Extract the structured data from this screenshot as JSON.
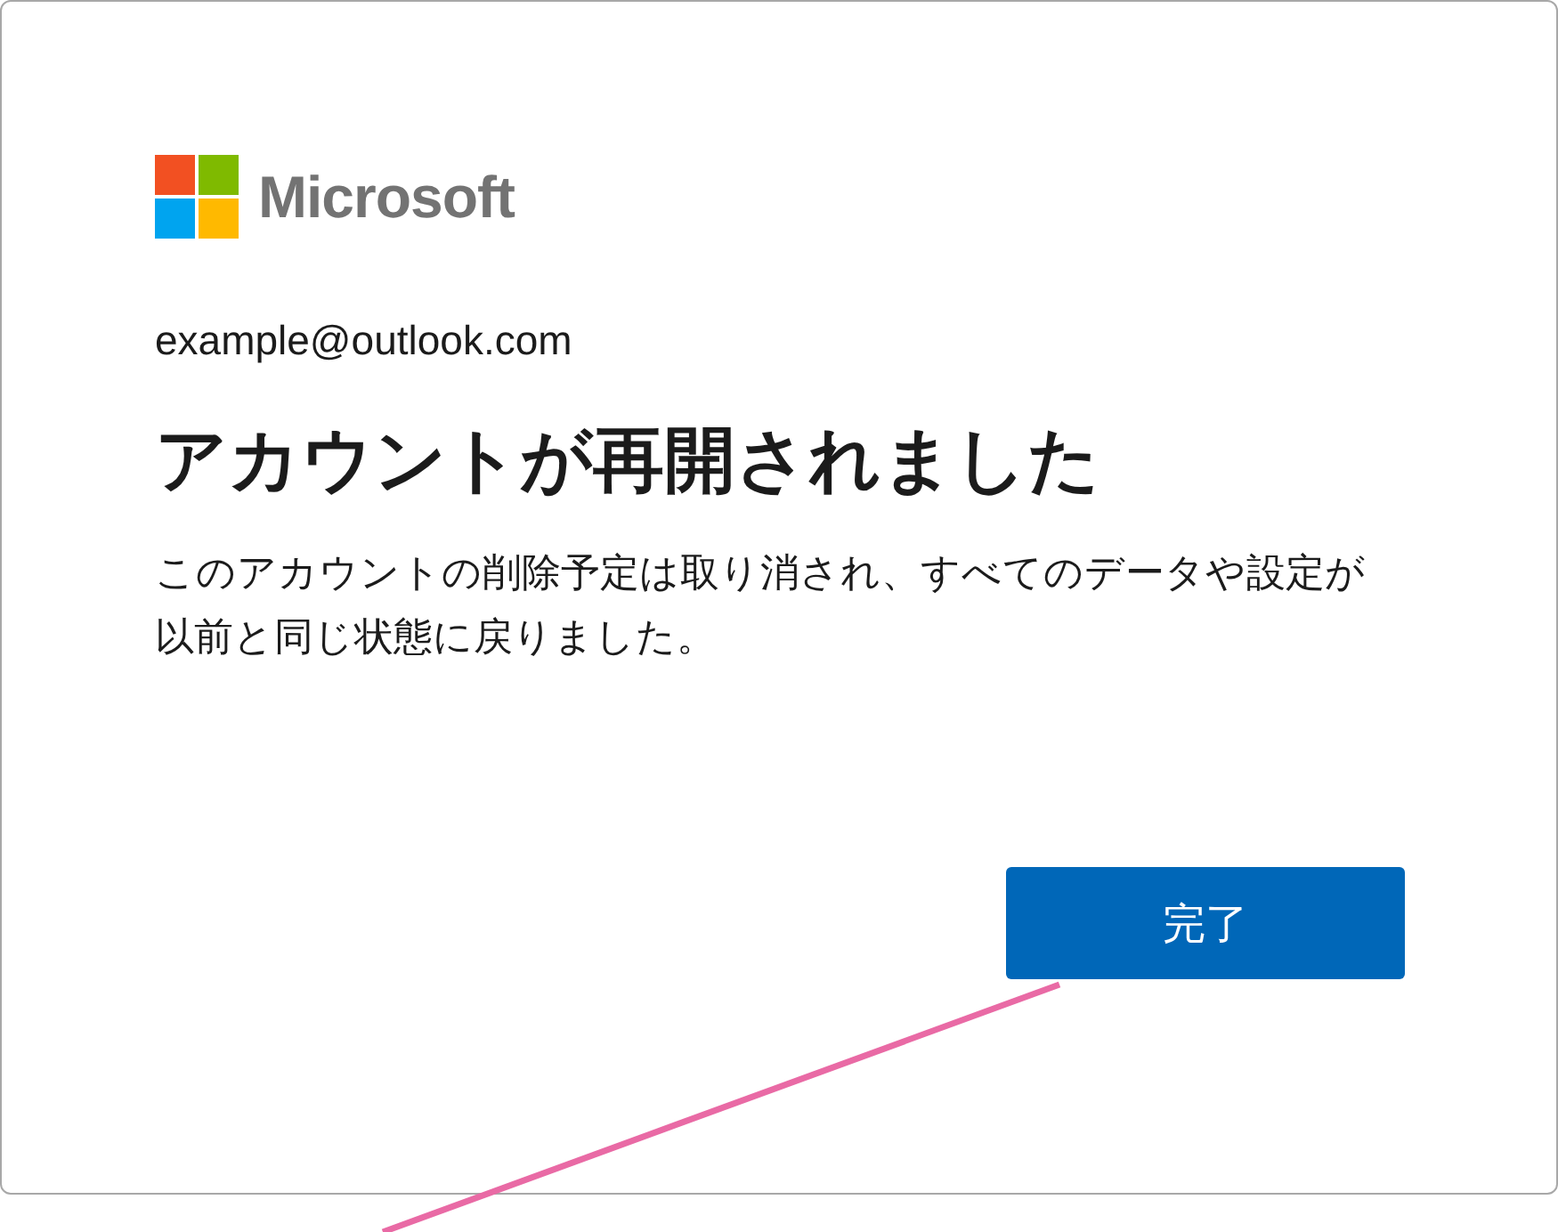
{
  "logo": {
    "text": "Microsoft"
  },
  "account": {
    "email": "example@outlook.com"
  },
  "title": "アカウントが再開されました",
  "description": "このアカウントの削除予定は取り消され、すべてのデータや設定が以前と同じ状態に戻りました。",
  "buttons": [
    {
      "label": "完了"
    }
  ]
}
